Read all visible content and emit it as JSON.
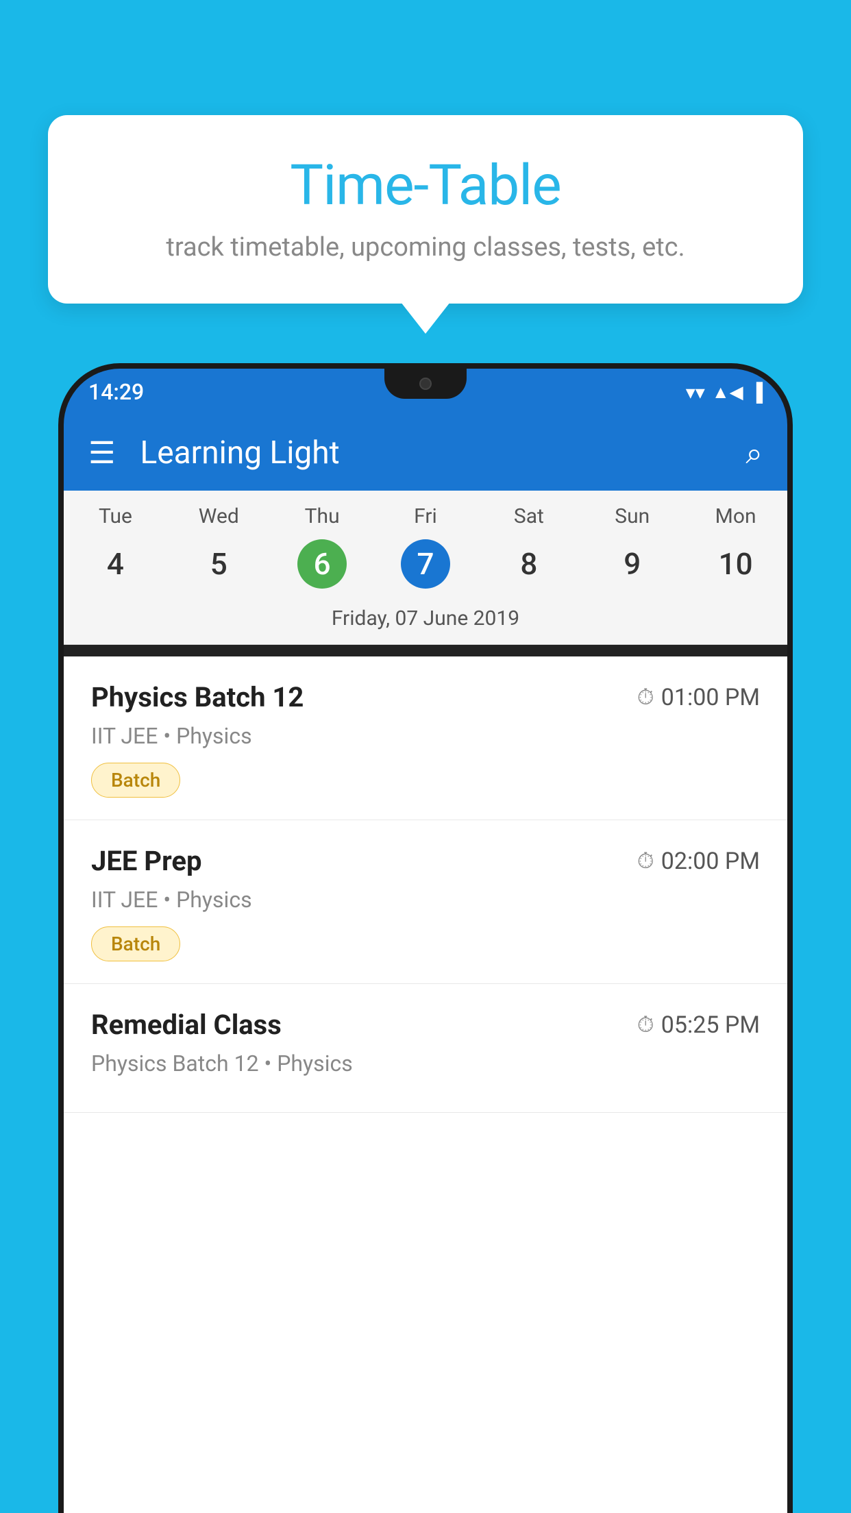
{
  "background": {
    "color": "#1ab8e8"
  },
  "tooltip": {
    "title": "Time-Table",
    "subtitle": "track timetable, upcoming classes, tests, etc."
  },
  "app": {
    "status_bar": {
      "time": "14:29"
    },
    "app_bar": {
      "title": "Learning Light",
      "menu_icon": "☰",
      "search_icon": "🔍"
    },
    "calendar": {
      "days": [
        {
          "name": "Tue",
          "num": "4",
          "state": "normal"
        },
        {
          "name": "Wed",
          "num": "5",
          "state": "normal"
        },
        {
          "name": "Thu",
          "num": "6",
          "state": "today"
        },
        {
          "name": "Fri",
          "num": "7",
          "state": "selected"
        },
        {
          "name": "Sat",
          "num": "8",
          "state": "normal"
        },
        {
          "name": "Sun",
          "num": "9",
          "state": "normal"
        },
        {
          "name": "Mon",
          "num": "10",
          "state": "normal"
        }
      ],
      "selected_date_label": "Friday, 07 June 2019"
    },
    "classes": [
      {
        "name": "Physics Batch 12",
        "time": "01:00 PM",
        "detail": "IIT JEE • Physics",
        "badge": "Batch"
      },
      {
        "name": "JEE Prep",
        "time": "02:00 PM",
        "detail": "IIT JEE • Physics",
        "badge": "Batch"
      },
      {
        "name": "Remedial Class",
        "time": "05:25 PM",
        "detail": "Physics Batch 12 • Physics",
        "badge": null
      }
    ]
  }
}
